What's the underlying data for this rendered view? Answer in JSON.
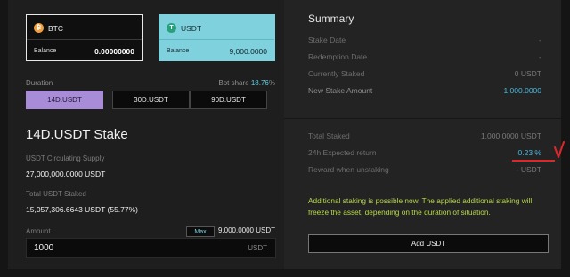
{
  "coins": {
    "btc": {
      "name": "BTC",
      "balance_label": "Balance",
      "balance": "0.00000000",
      "icon": "btc-icon",
      "color": "#f2a03d"
    },
    "usdt": {
      "name": "USDT",
      "balance_label": "Balance",
      "balance": "9,000.0000",
      "icon": "usdt-icon",
      "color": "#26a17b",
      "selected": true
    }
  },
  "duration": {
    "label": "Duration",
    "bot_share_label": "Bot share",
    "bot_share_value": "18.76",
    "bot_share_unit": "%",
    "options": [
      "14D.USDT",
      "30D.USDT",
      "90D.USDT"
    ],
    "selected": "14D.USDT"
  },
  "stake": {
    "title": "14D.USDT Stake",
    "supply_label": "USDT Circulating Supply",
    "supply_value": "27,000,000.0000 USDT",
    "staked_label": "Total USDT Staked",
    "staked_value": "15,057,306.6643 USDT (55.77%)",
    "amount_label": "Amount",
    "max_label": "Max",
    "available": "9,000.0000 USDT",
    "amount_value": "1000",
    "amount_unit": "USDT"
  },
  "summary": {
    "title": "Summary",
    "rows": [
      {
        "label": "Stake Date",
        "value": "-"
      },
      {
        "label": "Redemption Date",
        "value": "-"
      },
      {
        "label": "Currently Staked",
        "value": "0 USDT"
      },
      {
        "label": "New Stake Amount",
        "value": "1,000.0000"
      }
    ],
    "rows2": [
      {
        "label": "Total Staked",
        "value": "1,000.0000 USDT"
      },
      {
        "label": "24h Expected return",
        "value": "0.23 %"
      },
      {
        "label": "Reward when unstaking",
        "value": "- USDT"
      }
    ],
    "note": "Additional staking is possible now. The applied additional staking will freeze the asset, depending on the duration of situation.",
    "add_button": "Add USDT"
  },
  "colors": {
    "accent_purple": "#a98cd8",
    "accent_cyan": "#7fd1de",
    "value_blue": "#46b9e0",
    "note_green": "#b7d94a",
    "annotation_red": "#e0262a"
  }
}
